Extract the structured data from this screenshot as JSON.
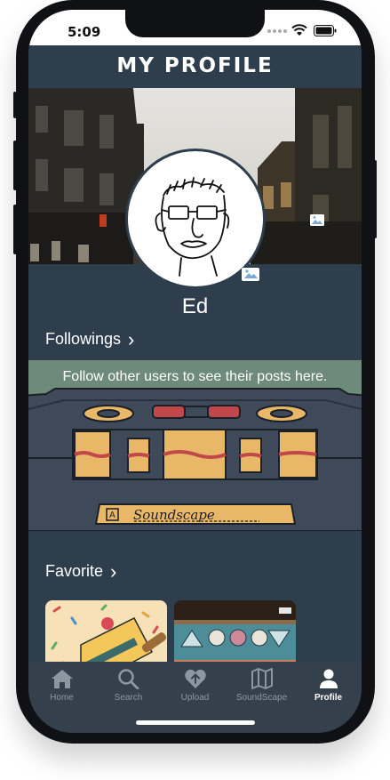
{
  "status": {
    "time": "5:09"
  },
  "header": {
    "title": "MY PROFILE"
  },
  "profile": {
    "name": "Ed"
  },
  "followings": {
    "label": "Followings",
    "chevron": "›",
    "empty_message": "Follow other users to see their posts here.",
    "cassette_label": "Soundscape",
    "cassette_side": "A"
  },
  "favorite": {
    "label": "Favorite",
    "chevron": "›"
  },
  "tabs": [
    {
      "label": "Home",
      "icon": "home-icon"
    },
    {
      "label": "Search",
      "icon": "search-icon"
    },
    {
      "label": "Upload",
      "icon": "upload-heart-icon"
    },
    {
      "label": "SoundScape",
      "icon": "map-icon"
    },
    {
      "label": "Profile",
      "icon": "profile-icon",
      "active": true
    }
  ],
  "colors": {
    "background": "#2f3e4c",
    "tabbar": "#34414d",
    "banner": "#6d8a7b",
    "cassette_orange": "#e8b768",
    "cassette_body": "#3e4a5a"
  }
}
